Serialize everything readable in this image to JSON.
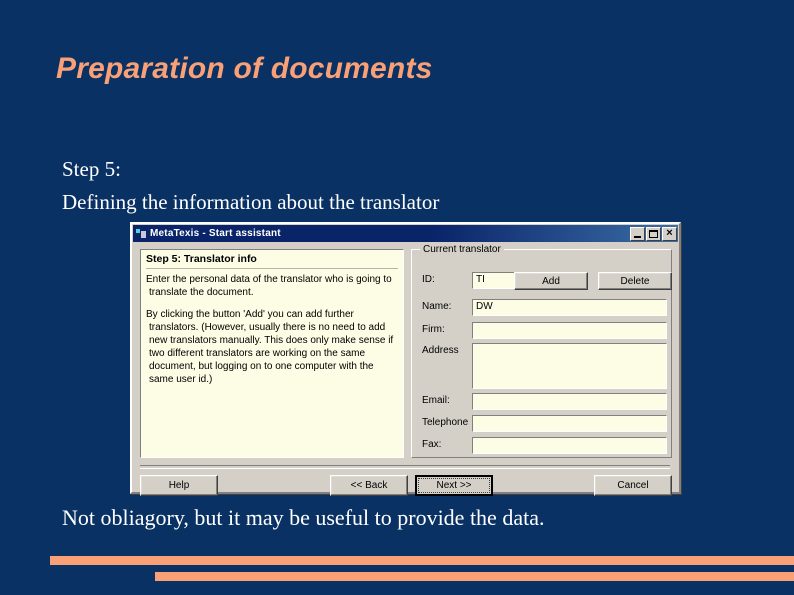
{
  "slide": {
    "title": "Preparation of documents",
    "intro_step": "Step 5:",
    "intro_description": "Defining the information about the translator",
    "caption": "Not obliagory, but it  may be useful to provide the data."
  },
  "colors": {
    "background": "#0a3163",
    "accent": "#f9a077",
    "slide_text": "#ffffff",
    "dialog_face": "#d4d0c8",
    "field_background": "#fdfce4",
    "titlebar_start": "#0a246a",
    "titlebar_end": "#3a6ea5"
  },
  "dialog": {
    "title": "MetaTexis - Start assistant",
    "caption_buttons": {
      "minimize": "Minimize",
      "maximize": "Maximize",
      "close": "Close"
    },
    "info_panel": {
      "heading": "Step 5: Translator info",
      "paragraphs": [
        "Enter the personal data of the translator who is going to translate the document.",
        "By clicking the button 'Add' you can add further translators. (However, usually there is no need to add new translators manually. This does only make sense if two different translators are working on the same document, but logging on to one computer with the same user id.)"
      ]
    },
    "group": {
      "legend": "Current translator",
      "id_label": "ID:",
      "id_value": "TI",
      "add_label": "Add",
      "delete_label": "Delete",
      "fields": [
        {
          "label": "Name:",
          "value": "DW"
        },
        {
          "label": "Firm:",
          "value": ""
        },
        {
          "label": "Address",
          "value": ""
        },
        {
          "label": "Email:",
          "value": ""
        },
        {
          "label": "Telephone",
          "value": ""
        },
        {
          "label": "Fax:",
          "value": ""
        }
      ]
    },
    "footer": {
      "help_label": "Help",
      "back_label": "<< Back",
      "next_label": "Next >>",
      "cancel_label": "Cancel"
    }
  }
}
